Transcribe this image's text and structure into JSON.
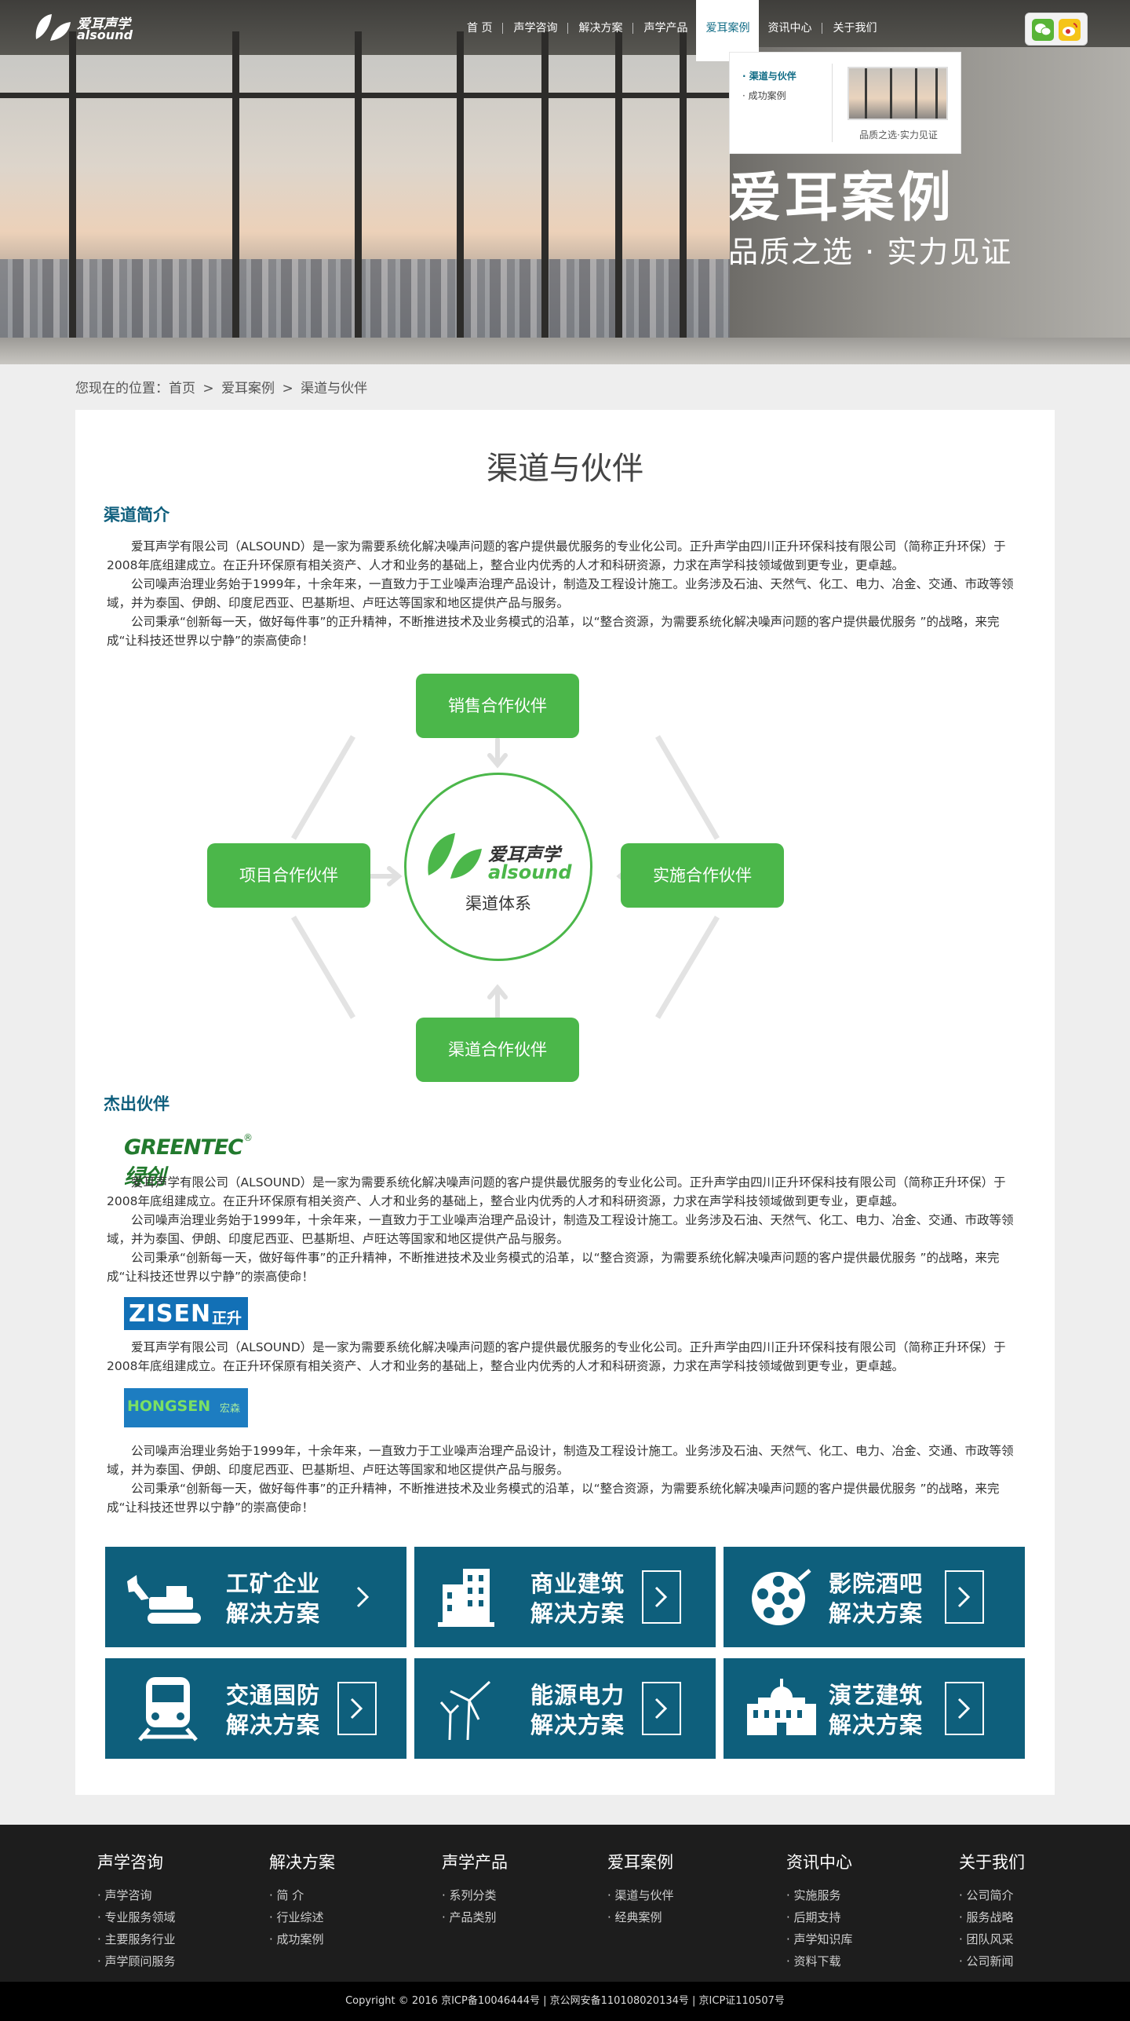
{
  "header": {
    "logo_cn": "爱耳声学",
    "logo_en": "alsound",
    "nav": [
      "首  页",
      "声学咨询",
      "解决方案",
      "声学产品",
      "爱耳案例",
      "资讯中心",
      "关于我们"
    ],
    "active_nav": "爱耳案例",
    "dropdown": {
      "links": [
        "· 渠道与伙伴",
        "· 成功案例"
      ],
      "caption": "品质之选·实力见证"
    }
  },
  "hero": {
    "title": "爱耳案例",
    "subtitle": "品质之选 · 实力见证"
  },
  "breadcrumb": [
    "您现在的位置：首页",
    ">",
    "爱耳案例",
    ">",
    "渠道与伙伴"
  ],
  "main": {
    "title": "渠道与伙伴",
    "intro_heading": "渠道简介",
    "intro_paragraphs": [
      "爱耳声学有限公司（ALSOUND）是一家为需要系统化解决噪声问题的客户提供最优服务的专业化公司。正升声学由四川正升环保科技有限公司（简称正升环保）于2008年底组建成立。在正升环保原有相关资产、人才和业务的基础上，整合业内优秀的人才和科研资源，力求在声学科技领域做到更专业，更卓越。",
      "公司噪声治理业务始于1999年，十余年来，一直致力于工业噪声治理产品设计，制造及工程设计施工。业务涉及石油、天然气、化工、电力、冶金、交通、市政等领域，并为泰国、伊朗、印度尼西亚、巴基斯坦、卢旺达等国家和地区提供产品与服务。",
      "公司秉承“创新每一天，做好每件事”的正升精神，不断推进技术及业务模式的沿革，以“整合资源，为需要系统化解决噪声问题的客户提供最优服务 ”的战略，来完成“让科技还世界以宁静”的崇高使命！"
    ],
    "diagram": {
      "top": "销售合作伙伴",
      "left": "项目合作伙伴",
      "right": "实施合作伙伴",
      "bottom": "渠道合作伙伴",
      "center_cn": "爱耳声学",
      "center_en": "alsound",
      "center_label": "渠道体系"
    },
    "partners_heading": "杰出伙伴",
    "partners": [
      {
        "logo_text": "GREENTEC绿创",
        "logo_mark": "®",
        "paragraphs": [
          "爱耳声学有限公司（ALSOUND）是一家为需要系统化解决噪声问题的客户提供最优服务的专业化公司。正升声学由四川正升环保科技有限公司（简称正升环保）于2008年底组建成立。在正升环保原有相关资产、人才和业务的基础上，整合业内优秀的人才和科研资源，力求在声学科技领域做到更专业，更卓越。",
          "公司噪声治理业务始于1999年，十余年来，一直致力于工业噪声治理产品设计，制造及工程设计施工。业务涉及石油、天然气、化工、电力、冶金、交通、市政等领域，并为泰国、伊朗、印度尼西亚、巴基斯坦、卢旺达等国家和地区提供产品与服务。",
          "公司秉承“创新每一天，做好每件事”的正升精神，不断推进技术及业务模式的沿革，以“整合资源，为需要系统化解决噪声问题的客户提供最优服务 ”的战略，来完成“让科技还世界以宁静”的崇高使命！"
        ]
      },
      {
        "logo_text": "ZISEN",
        "logo_cn": "正升",
        "paragraphs": [
          "爱耳声学有限公司（ALSOUND）是一家为需要系统化解决噪声问题的客户提供最优服务的专业化公司。正升声学由四川正升环保科技有限公司（简称正升环保）于2008年底组建成立。在正升环保原有相关资产、人才和业务的基础上，整合业内优秀的人才和科研资源，力求在声学科技领域做到更专业，更卓越。"
        ]
      },
      {
        "logo_text": "HONGSEN",
        "logo_cn": "宏森",
        "paragraphs": [
          "公司噪声治理业务始于1999年，十余年来，一直致力于工业噪声治理产品设计，制造及工程设计施工。业务涉及石油、天然气、化工、电力、冶金、交通、市政等领域，并为泰国、伊朗、印度尼西亚、巴基斯坦、卢旺达等国家和地区提供产品与服务。",
          "公司秉承“创新每一天，做好每件事”的正升精神，不断推进技术及业务模式的沿革，以“整合资源，为需要系统化解决噪声问题的客户提供最优服务 ”的战略，来完成“让科技还世界以宁静”的崇高使命！"
        ]
      }
    ],
    "solutions": [
      {
        "line1": "工矿企业",
        "line2": "解决方案",
        "icon": "excavator-icon"
      },
      {
        "line1": "商业建筑",
        "line2": "解决方案",
        "icon": "building-icon"
      },
      {
        "line1": "影院酒吧",
        "line2": "解决方案",
        "icon": "film-reel-icon"
      },
      {
        "line1": "交通国防",
        "line2": "解决方案",
        "icon": "train-icon"
      },
      {
        "line1": "能源电力",
        "line2": "解决方案",
        "icon": "wind-turbine-icon"
      },
      {
        "line1": "演艺建筑",
        "line2": "解决方案",
        "icon": "theater-icon"
      }
    ]
  },
  "footer": {
    "columns": [
      {
        "heading": "声学咨询",
        "links": [
          "· 声学咨询",
          "· 专业服务领域",
          "· 主要服务行业",
          "· 声学顾问服务"
        ]
      },
      {
        "heading": "解决方案",
        "links": [
          "· 简  介",
          "· 行业综述",
          "· 成功案例"
        ]
      },
      {
        "heading": "声学产品",
        "links": [
          "· 系列分类",
          "· 产品类别"
        ]
      },
      {
        "heading": "爱耳案例",
        "links": [
          "· 渠道与伙伴",
          "· 经典案例"
        ]
      },
      {
        "heading": "资讯中心",
        "links": [
          "· 实施服务",
          "· 后期支持",
          "· 声学知识库",
          "· 资料下载"
        ]
      },
      {
        "heading": "关于我们",
        "links": [
          "· 公司简介",
          "· 服务战略",
          "· 团队风采",
          "· 公司新闻"
        ]
      }
    ],
    "copyright": "Copyright © 2016  京ICP备10046444号 | 京公网安备110108020134号 | 京ICP证110507号"
  },
  "colors": {
    "brand_green": "#4bb74a",
    "brand_teal": "#0e5f7c",
    "footer_bg": "#1d1d1d"
  }
}
